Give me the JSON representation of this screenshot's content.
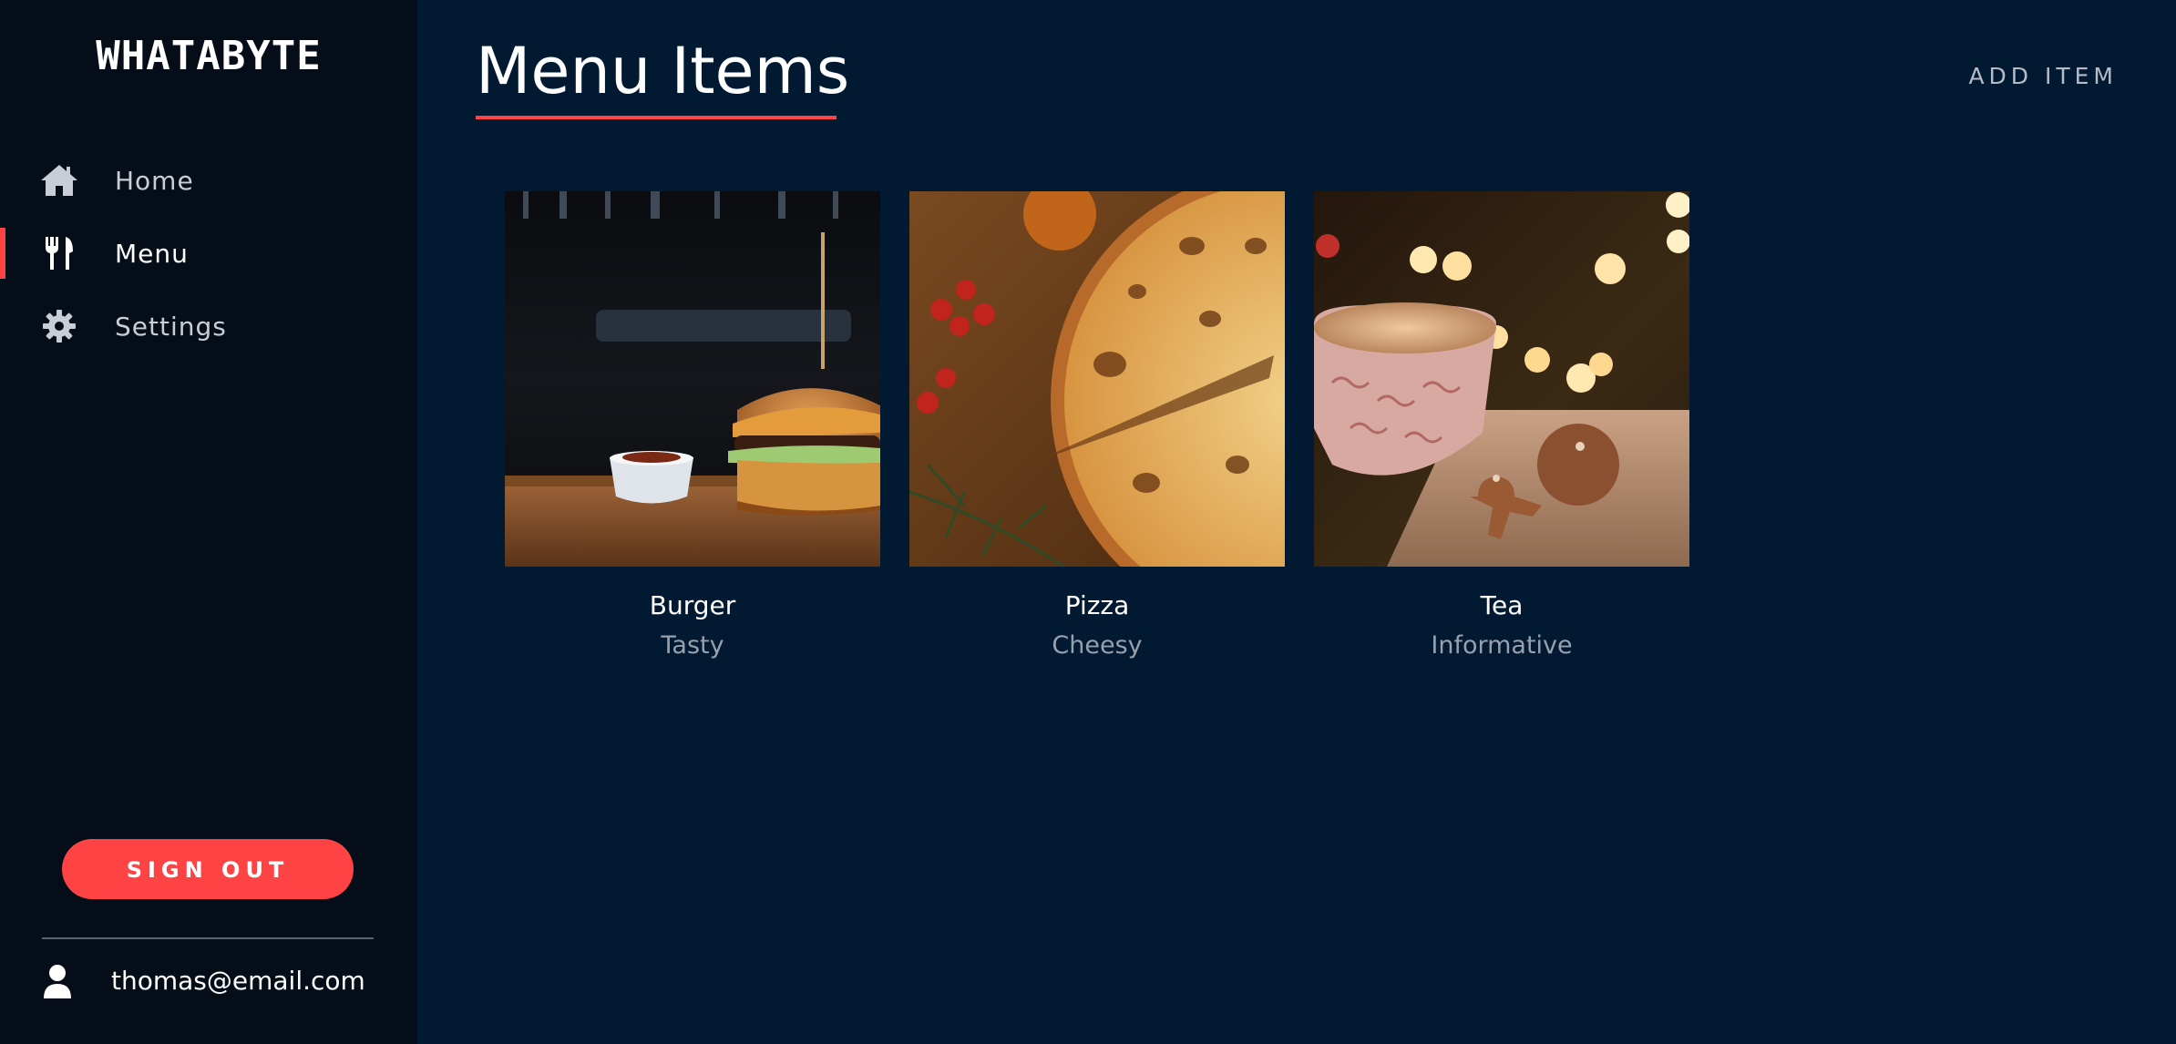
{
  "sidebar": {
    "brand": "WHATABYTE",
    "nav": [
      {
        "label": "Home",
        "icon": "home-icon",
        "active": false
      },
      {
        "label": "Menu",
        "icon": "utensils-icon",
        "active": true
      },
      {
        "label": "Settings",
        "icon": "gear-icon",
        "active": false
      }
    ],
    "sign_out_label": "SIGN OUT",
    "user_icon": "user-icon",
    "user_email": "thomas@email.com"
  },
  "main": {
    "title": "Menu Items",
    "add_item_label": "ADD ITEM",
    "items": [
      {
        "name": "Burger",
        "description": "Tasty",
        "image": "burger photo"
      },
      {
        "name": "Pizza",
        "description": "Cheesy",
        "image": "pizza photo"
      },
      {
        "name": "Tea",
        "description": "Informative",
        "image": "tea photo"
      }
    ]
  },
  "colors": {
    "accent": "#fd4344",
    "sidebar_bg": "#040d18",
    "main_bg": "#011931",
    "muted_text": "#97a0ad"
  }
}
